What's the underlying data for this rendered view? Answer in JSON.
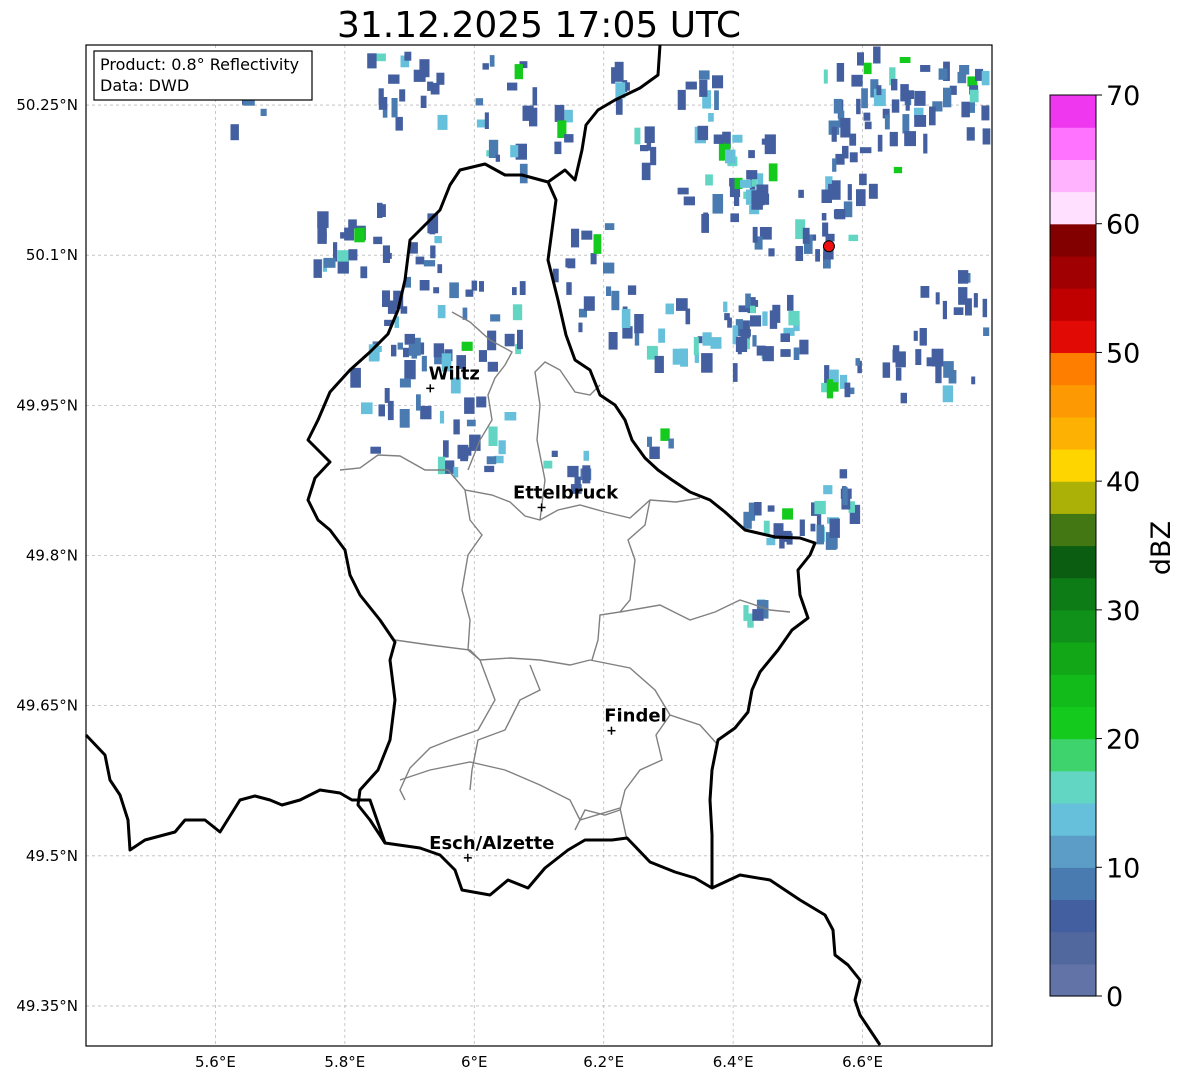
{
  "title": "31.12.2025 17:05 UTC",
  "info_box": {
    "product": "Product: 0.8° Reflectivity",
    "data": "Data: DWD"
  },
  "axes": {
    "lon_range": [
      5.4,
      6.8
    ],
    "lat_range": [
      49.31,
      50.31
    ],
    "lon_ticks": [
      {
        "value": 5.6,
        "label": "5.6°E"
      },
      {
        "value": 5.8,
        "label": "5.8°E"
      },
      {
        "value": 6.0,
        "label": "6°E"
      },
      {
        "value": 6.2,
        "label": "6.2°E"
      },
      {
        "value": 6.4,
        "label": "6.4°E"
      },
      {
        "value": 6.6,
        "label": "6.6°E"
      }
    ],
    "lat_ticks": [
      {
        "value": 50.25,
        "label": "50.25°N"
      },
      {
        "value": 50.1,
        "label": "50.1°N"
      },
      {
        "value": 49.95,
        "label": "49.95°N"
      },
      {
        "value": 49.8,
        "label": "49.8°N"
      },
      {
        "value": 49.65,
        "label": "49.65°N"
      },
      {
        "value": 49.5,
        "label": "49.5°N"
      },
      {
        "value": 49.35,
        "label": "49.35°N"
      }
    ],
    "grid": true
  },
  "cities": [
    {
      "name": "Wiltz",
      "lon": 5.932,
      "lat": 49.967
    },
    {
      "name": "Ettelbruck",
      "lon": 6.104,
      "lat": 49.848
    },
    {
      "name": "Findel",
      "lon": 6.212,
      "lat": 49.625
    },
    {
      "name": "Esch/Alzette",
      "lon": 5.99,
      "lat": 49.498
    }
  ],
  "radar_site": {
    "lon": 6.548,
    "lat": 50.109,
    "color": "#ee1111"
  },
  "colorbar": {
    "label": "dBZ",
    "min": 0,
    "max": 70,
    "step": 2.5,
    "ticks": [
      "0",
      "10",
      "20",
      "30",
      "40",
      "50",
      "60",
      "70"
    ],
    "colors": [
      "#6273a8",
      "#51689f",
      "#435f9f",
      "#4a7bb0",
      "#5b9dc6",
      "#66c0db",
      "#62d6c2",
      "#3ed36c",
      "#14ca1c",
      "#12bb1a",
      "#12a716",
      "#10921a",
      "#0e7c16",
      "#0b5d12",
      "#437714",
      "#abb106",
      "#ffd500",
      "#fdb203",
      "#fd9902",
      "#fe7f00",
      "#e10a05",
      "#c00000",
      "#a00002",
      "#820000",
      "#ffe1ff",
      "#ffb3ff",
      "#ff73ff",
      "#ee37ee"
    ]
  }
}
